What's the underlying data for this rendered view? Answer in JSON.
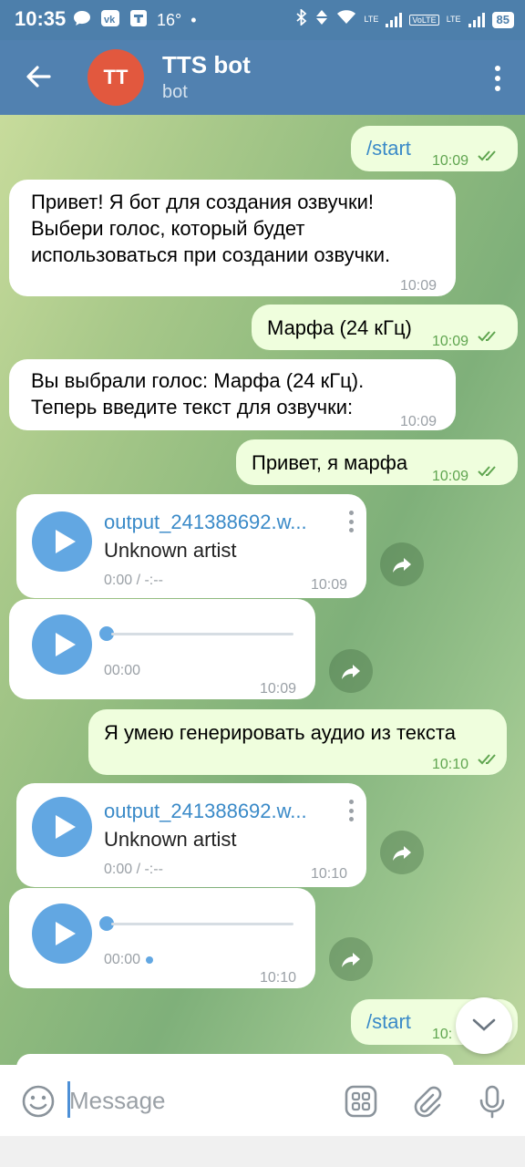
{
  "status_bar": {
    "time": "10:35",
    "temperature": "16°",
    "lte1": "LTE",
    "volte": "VoLTE",
    "lte2": "LTE",
    "battery": "85"
  },
  "header": {
    "avatar_initials": "TT",
    "title": "TTS bot",
    "subtitle": "bot"
  },
  "messages": [
    {
      "dir": "out",
      "text": "/start",
      "time": "10:09"
    },
    {
      "dir": "in",
      "text": "Привет! Я бот для создания озвучки! Выбери голос, который будет использоваться при создании озвучки.",
      "time": "10:09"
    },
    {
      "dir": "out",
      "text": "Марфа (24 кГц)",
      "time": "10:09"
    },
    {
      "dir": "in",
      "text": "Вы выбрали голос: Марфа (24 кГц). Теперь введите текст для озвучки:",
      "time": "10:09"
    },
    {
      "dir": "out",
      "text": "Привет, я марфа",
      "time": "10:09"
    },
    {
      "dir": "in",
      "type": "audio_file",
      "filename": "output_241388692.w...",
      "artist": "Unknown artist",
      "duration": "0:00 / -:--",
      "time": "10:09"
    },
    {
      "dir": "in",
      "type": "voice",
      "elapsed": "00:00",
      "time": "10:09"
    },
    {
      "dir": "out",
      "text": "Я умею генерировать аудио из текста",
      "time": "10:10"
    },
    {
      "dir": "in",
      "type": "audio_file",
      "filename": "output_241388692.w...",
      "artist": "Unknown artist",
      "duration": "0:00 / -:--",
      "time": "10:10"
    },
    {
      "dir": "in",
      "type": "voice",
      "elapsed": "00:00",
      "time": "10:10"
    },
    {
      "dir": "out",
      "text": "/start",
      "time": "10:"
    }
  ],
  "input": {
    "placeholder": "Message"
  },
  "colors": {
    "header": "#5181b0",
    "status_bar": "#4d7fab",
    "outgoing_bubble": "#effedd",
    "incoming_bubble": "#ffffff",
    "accent": "#62a7e2",
    "avatar": "#e2583e"
  }
}
